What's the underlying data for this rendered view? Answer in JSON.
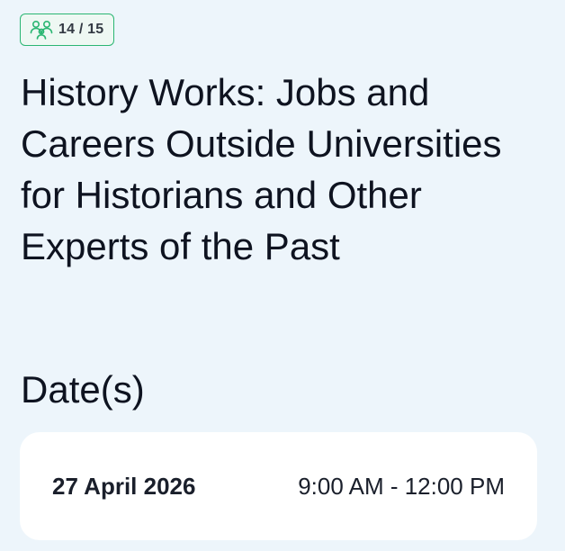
{
  "badge": {
    "icon": "people-group-icon",
    "text": "14 / 15",
    "accent_color": "#2bb673"
  },
  "event": {
    "title": "History Works: Jobs and Careers Outside Universities for Historians and Other Experts of the Past"
  },
  "dates_section": {
    "heading": "Date(s)",
    "entries": [
      {
        "date": "27 April 2026",
        "time": "9:00 AM - 12:00 PM"
      }
    ]
  }
}
